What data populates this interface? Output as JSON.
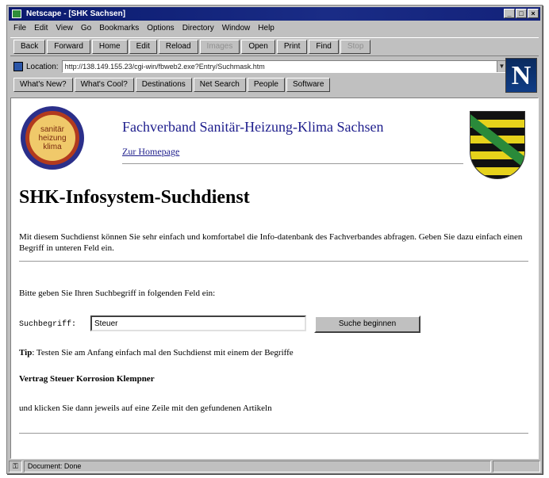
{
  "window": {
    "title": "Netscape - [SHK Sachsen]",
    "buttons": [
      "_",
      "□",
      "×"
    ]
  },
  "menu": [
    "File",
    "Edit",
    "View",
    "Go",
    "Bookmarks",
    "Options",
    "Directory",
    "Window",
    "Help"
  ],
  "toolbar": {
    "buttons": [
      {
        "label": "Back",
        "disabled": false
      },
      {
        "label": "Forward",
        "disabled": false
      },
      {
        "label": "Home",
        "disabled": false
      },
      {
        "label": "Edit",
        "disabled": false
      },
      {
        "label": "Reload",
        "disabled": false
      },
      {
        "label": "Images",
        "disabled": true
      },
      {
        "label": "Open",
        "disabled": false
      },
      {
        "label": "Print",
        "disabled": false
      },
      {
        "label": "Find",
        "disabled": false
      },
      {
        "label": "Stop",
        "disabled": true
      }
    ]
  },
  "location": {
    "label": "Location:",
    "url": "http://138.149.155.23/cgi-win/fbweb2.exe?Entry/Suchmask.htm"
  },
  "directory_buttons": [
    "What's New?",
    "What's Cool?",
    "Destinations",
    "Net Search",
    "People",
    "Software"
  ],
  "brand_letter": "N",
  "page": {
    "logo_text": [
      "sanitär",
      "heizung",
      "klima"
    ],
    "org_title": "Fachverband Sanitär-Heizung-Klima Sachsen",
    "home_link": "Zur Homepage",
    "heading": "SHK-Infosystem-Suchdienst",
    "intro": "Mit diesem Suchdienst können Sie sehr einfach und komfortabel die Info-datenbank des Fachverbandes abfragen. Geben Sie dazu einfach einen Begriff in unteren Feld ein.",
    "prompt": "Bitte geben Sie Ihren Suchbegriff in folgenden Feld ein:",
    "search_label": "Suchbegriff:",
    "search_value": "Steuer",
    "search_button": "Suche beginnen",
    "tip_label": "Tip",
    "tip_text": ": Testen Sie am Anfang einfach mal den Suchdienst mit einem der Begriffe",
    "terms": "Vertrag Steuer Korrosion Klempner",
    "outro": "und klicken Sie dann jeweils auf eine Zeile mit den gefundenen Artikeln"
  },
  "status": {
    "text": "Document: Done"
  }
}
